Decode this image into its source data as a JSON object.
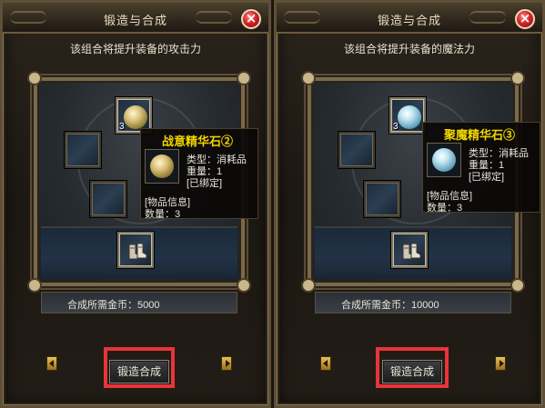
{
  "colors": {
    "title_text": "#e8dcc0",
    "highlight": "#e8343a",
    "tooltip_title": "#f0d400",
    "gem_gold": "#c9b06a",
    "gem_blue": "#86c2d8"
  },
  "panels": [
    {
      "window_title": "锻造与合成",
      "close_label": "×",
      "description": "该组合将提升装备的攻击力",
      "slots": {
        "top": {
          "qty": "3",
          "icon": "gold-gem-icon"
        },
        "middle_left": {
          "icon": "empty-slot"
        },
        "lower_left": {
          "icon": "empty-slot"
        },
        "output": {
          "icon": "boots-icon"
        }
      },
      "tooltip": {
        "title": "战意精华石②",
        "title_color": "#f0d400",
        "type_line": "类型：消耗品",
        "weight_line": "重量：1",
        "bound_line": "[已绑定]",
        "info_line": "[物品信息]",
        "count_line": "数量：3",
        "icon": "gold-gem-icon"
      },
      "gold_cost": "合成所需金币：5000",
      "button_label": "锻造合成",
      "prev_icon": "arrow-left-icon",
      "next_icon": "arrow-right-icon"
    },
    {
      "window_title": "锻造与合成",
      "close_label": "×",
      "description": "该组合将提升装备的魔法力",
      "slots": {
        "top": {
          "qty": "3",
          "icon": "blue-gem-icon"
        },
        "middle_left": {
          "icon": "empty-slot"
        },
        "lower_left": {
          "icon": "empty-slot"
        },
        "output": {
          "icon": "boots-icon"
        }
      },
      "tooltip": {
        "title": "聚魔精华石③",
        "title_color": "#f0d400",
        "type_line": "类型：消耗品",
        "weight_line": "重量：1",
        "bound_line": "[已绑定]",
        "info_line": "[物品信息]",
        "count_line": "数量：3",
        "icon": "blue-gem-icon"
      },
      "gold_cost": "合成所需金币：10000",
      "button_label": "锻造合成",
      "prev_icon": "arrow-left-icon",
      "next_icon": "arrow-right-icon"
    }
  ]
}
